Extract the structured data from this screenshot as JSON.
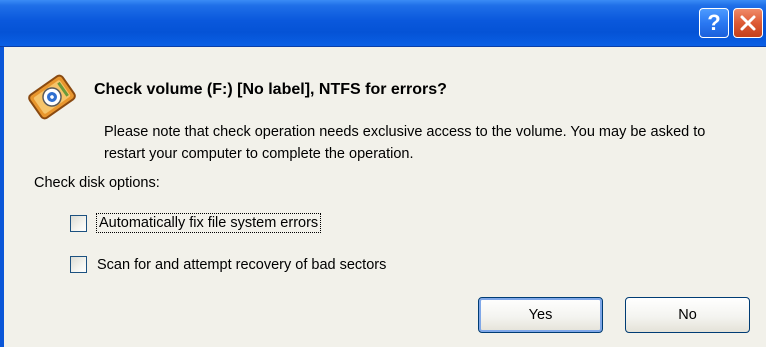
{
  "titlebar": {
    "help_label": "?",
    "close_icon": "close-icon"
  },
  "dialog": {
    "icon": "disk-check-icon",
    "heading": "Check volume (F:) [No label], NTFS for errors?",
    "note": "Please note that check operation needs exclusive access to the volume. You may be asked to restart your computer to complete the operation.",
    "options_label": "Check disk options:",
    "options": [
      {
        "label": "Automatically fix file system errors",
        "checked": false,
        "focused": true
      },
      {
        "label": "Scan for and attempt recovery of bad sectors",
        "checked": false,
        "focused": false
      }
    ]
  },
  "buttons": {
    "yes": "Yes",
    "no": "No"
  },
  "colors": {
    "titlebar": "#0553d6",
    "close_button": "#dd5a35",
    "dialog_background": "#f2f1ea"
  }
}
